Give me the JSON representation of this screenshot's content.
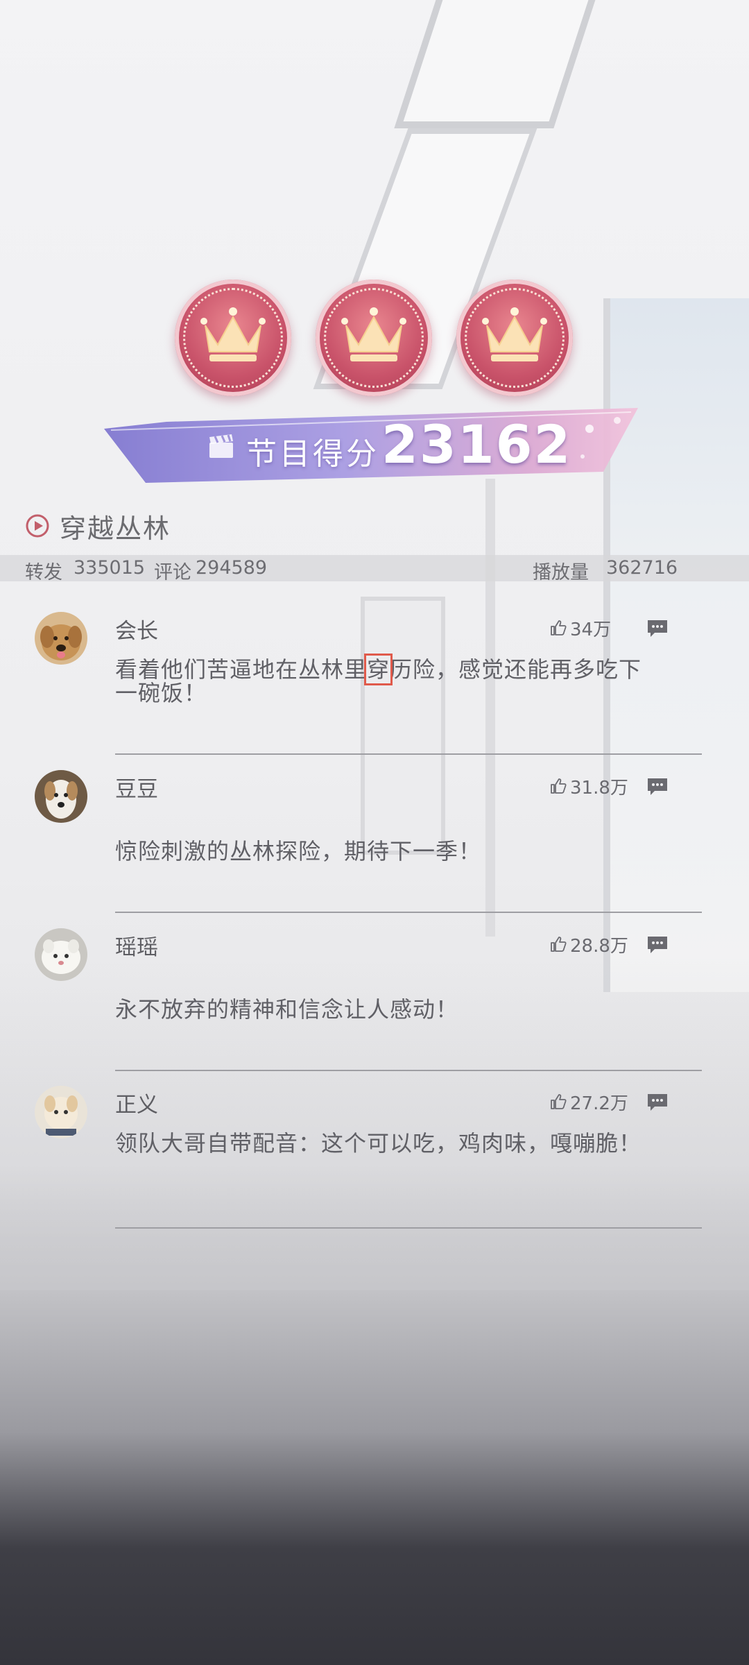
{
  "score": {
    "label": "节目得分",
    "value": "23162",
    "crown_count": 3
  },
  "program": {
    "title": "穿越丛林"
  },
  "stats": {
    "forward_label": "转发",
    "forward_count": "335015",
    "comment_label": "评论",
    "comment_count": "294589",
    "play_label": "播放量",
    "play_count": "362716"
  },
  "comments": [
    {
      "author": "会长",
      "likes": "34万",
      "text_before": "看着他们苦逼地在丛林里",
      "text_highlight": "穿",
      "text_after": "历险，感觉还能再多吃下一碗饭！"
    },
    {
      "author": "豆豆",
      "likes": "31.8万",
      "text": "惊险刺激的丛林探险，期待下一季！"
    },
    {
      "author": "瑶瑶",
      "likes": "28.8万",
      "text": "永不放弃的精神和信念让人感动！"
    },
    {
      "author": "正义",
      "likes": "27.2万",
      "text": "领队大哥自带配音：这个可以吃，鸡肉味，嘎嘣脆！"
    }
  ],
  "colors": {
    "crown_badge": "#c9536a",
    "banner_purple": "#8e84d6",
    "banner_pink": "#e8a6c8",
    "highlight_box": "#e05a4b",
    "text_gray": "#606066"
  },
  "icons": {
    "play": "play-circle-icon",
    "thumb": "thumbs-up-icon",
    "reply": "comment-bubble-icon",
    "clapper": "clapperboard-icon",
    "crown": "crown-icon"
  }
}
